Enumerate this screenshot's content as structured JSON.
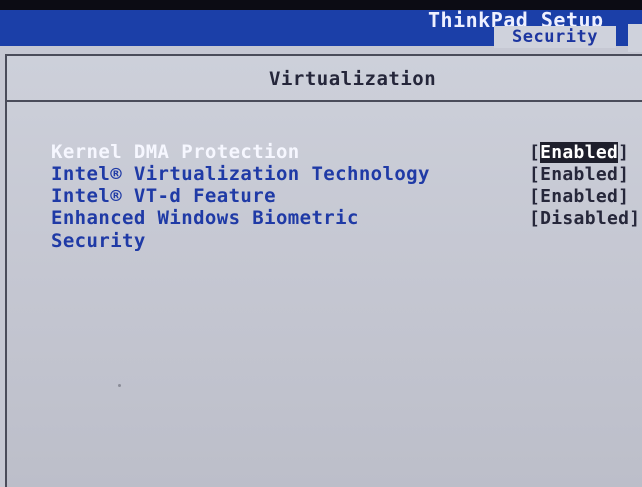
{
  "window": {
    "title": "ThinkPad Setup",
    "active_tab": "Security"
  },
  "section": {
    "title": "Virtualization"
  },
  "settings": [
    {
      "label": "Kernel DMA Protection",
      "value": "Enabled",
      "selected": true
    },
    {
      "label": "Intel® Virtualization Technology",
      "value": "Enabled",
      "selected": false
    },
    {
      "label": "Intel® VT-d Feature",
      "value": "Enabled",
      "selected": false
    },
    {
      "label": "Enhanced Windows Biometric",
      "label_line2": "Security",
      "value": "Disabled",
      "selected": false
    }
  ],
  "brackets": {
    "open": "[",
    "close": "]"
  },
  "colors": {
    "title_bar": "#1b3fa8",
    "screen_background": "#c6c8d3",
    "label_text": "#1f3aa6",
    "selected_label_text": "#f6f7ff",
    "value_text": "#26273a",
    "value_highlight_bg": "#1e1f2c"
  }
}
